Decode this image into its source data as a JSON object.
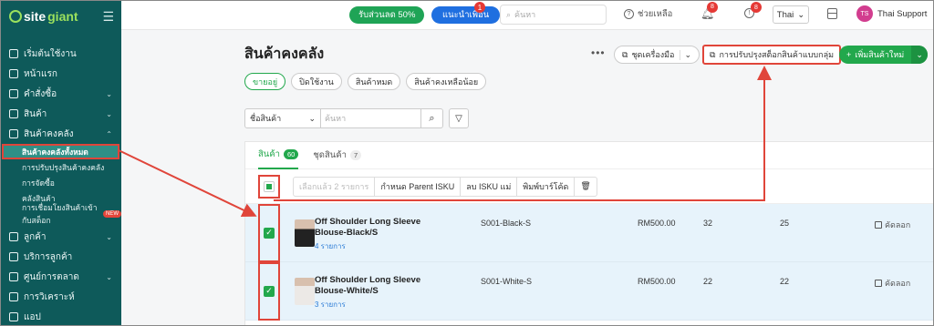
{
  "brand": {
    "site": "site",
    "giant": "giant"
  },
  "sidebar": {
    "items": [
      {
        "label": "เริ่มต้นใช้งาน",
        "icon": "rocket-icon",
        "chevron": ""
      },
      {
        "label": "หน้าแรก",
        "icon": "home-icon",
        "chevron": ""
      },
      {
        "label": "คำสั่งซื้อ",
        "icon": "clipboard-icon",
        "chevron": "⌄"
      },
      {
        "label": "สินค้า",
        "icon": "box-icon",
        "chevron": "⌄"
      },
      {
        "label": "สินค้าคงคลัง",
        "icon": "inventory-icon",
        "chevron": "⌃"
      }
    ],
    "sub_items": [
      {
        "label": "สินค้าคงคลังทั้งหมด",
        "active": true
      },
      {
        "label": "การปรับปรุงสินค้าคงคลัง"
      },
      {
        "label": "การจัดซื้อ"
      },
      {
        "label": "คลังสินค้า"
      },
      {
        "label": "การเชื่อมโยงสินค้าเข้ากับสต็อก",
        "badge": "NEW"
      }
    ],
    "items2": [
      {
        "label": "ลูกค้า",
        "icon": "users-icon",
        "chevron": "⌄"
      },
      {
        "label": "บริการลูกค้า",
        "icon": "chat-icon",
        "chevron": ""
      },
      {
        "label": "ศูนย์การตลาด",
        "icon": "percent-icon",
        "chevron": "⌄"
      },
      {
        "label": "การวิเคราะห์",
        "icon": "chart-icon",
        "chevron": ""
      },
      {
        "label": "แอป",
        "icon": "apps-icon",
        "chevron": ""
      }
    ]
  },
  "topbar": {
    "promo": "รับส่วนลด 50%",
    "refer": "แนะนำเพื่อน",
    "refer_badge": "1",
    "search_placeholder": "ค้นหา",
    "help": "ช่วยเหลือ",
    "bell_badge": "8",
    "alert_badge": "8",
    "language": "Thai",
    "avatar_initials": "TS",
    "user": "Thai Support"
  },
  "page": {
    "title": "สินค้าคงคลัง",
    "more": "•••",
    "tools_btn": "ชุดเครื่องมือ",
    "adjust_btn": "การปรับปรุงสต็อกสินค้าแบบกลุ่ม",
    "add_btn": "เพิ่มสินค้าใหม่"
  },
  "status_tabs": [
    "ขายอยู่",
    "ปิดใช้งาน",
    "สินค้าหมด",
    "สินค้าคงเหลือน้อย"
  ],
  "filter": {
    "field": "ชื่อสินค้า",
    "placeholder": "ค้นหา"
  },
  "table": {
    "tabs": [
      {
        "label": "สินค้า",
        "count": "60"
      },
      {
        "label": "ชุดสินค้า",
        "count": "7"
      }
    ],
    "bulk_actions": [
      "เลือกแล้ว 2 รายการ",
      "กำหนด Parent ISKU",
      "ลบ ISKU แม่",
      "พิมพ์บาร์โค้ด"
    ],
    "rows": [
      {
        "name": "Off Shoulder Long Sleeve Blouse-Black/S",
        "sub": "4 รายการ",
        "sku": "S001-Black-S",
        "price": "RM500.00",
        "qty1": "32",
        "qty2": "25",
        "copy": "คัดลอก"
      },
      {
        "name": "Off Shoulder Long Sleeve Blouse-White/S",
        "sub": "3 รายการ",
        "sku": "S001-White-S",
        "price": "RM500.00",
        "qty1": "22",
        "qty2": "22",
        "copy": "คัดลอก"
      }
    ]
  },
  "colors": {
    "sidebar": "#0e5a5a",
    "accent": "#22a84c",
    "highlight": "#e0453a"
  }
}
